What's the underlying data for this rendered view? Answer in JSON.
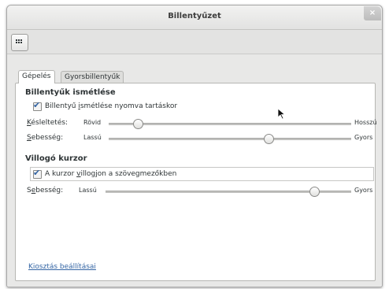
{
  "window": {
    "title": "Billentyűzet",
    "close_label": "×"
  },
  "tabs": [
    {
      "label": "Gépelés",
      "active": true
    },
    {
      "label": "Gyorsbillentyűk",
      "active": false
    }
  ],
  "repeat": {
    "section_title": "Billentyűk ismétlése",
    "checkbox_pre": "Billentyű ",
    "checkbox_u": "i",
    "checkbox_post": "smétlése nyomva tartáskor",
    "checked": true,
    "delay": {
      "label_u": "K",
      "label_rest": "ésleltetés:",
      "min": "Rövid",
      "max": "Hosszú",
      "value": 0.12
    },
    "speed": {
      "label_u": "S",
      "label_rest": "ebesség:",
      "min": "Lassú",
      "max": "Gyors",
      "value": 0.66
    }
  },
  "cursor_blink": {
    "section_title": "Villogó kurzor",
    "checkbox_pre": "A kurzor ",
    "checkbox_u": "v",
    "checkbox_post": "illogjon a szövegmezőkben",
    "checked": true,
    "speed": {
      "label_pre": "S",
      "label_u": "e",
      "label_rest": "besség:",
      "min": "Lassú",
      "max": "Gyors",
      "value": 0.85
    }
  },
  "layout_link": "Kiosztás beállításai",
  "colors": {
    "accent": "#3465a4",
    "background": "#e8e8e7"
  }
}
